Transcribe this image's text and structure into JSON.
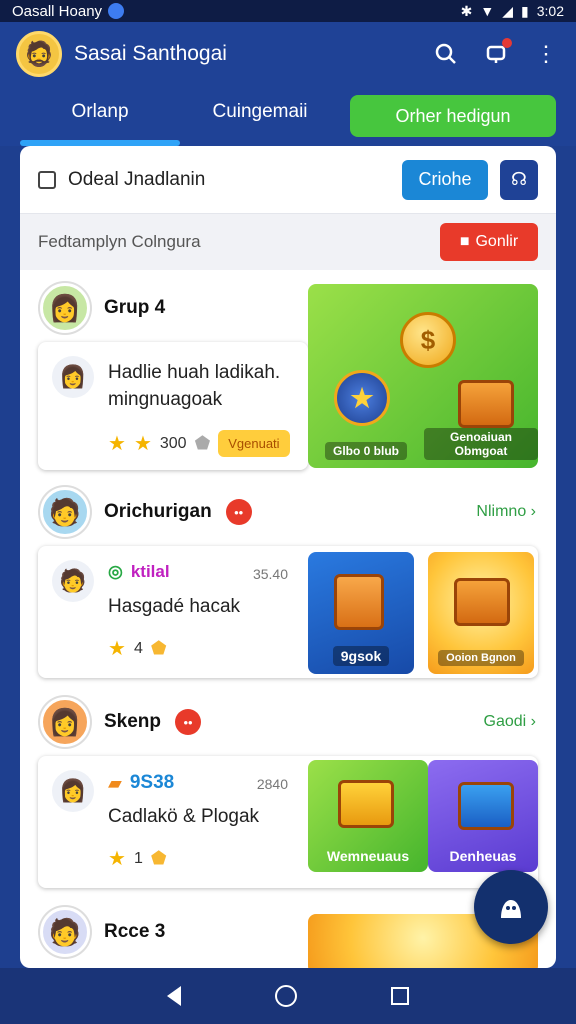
{
  "status": {
    "carrier": "Oasall Hoany",
    "time": "3:02"
  },
  "appbar": {
    "title": "Sasai Santhogai",
    "search_icon": "search-icon",
    "notif_icon": "notification-icon",
    "more_icon": "more-vert-icon"
  },
  "tabs": [
    {
      "label": "Orlanp",
      "active": true
    },
    {
      "label": "Cuingemaii",
      "active": false
    }
  ],
  "tab_cta": {
    "label": "Orher hedigun"
  },
  "filter": {
    "label": "Odeal Jnadlanin",
    "button": "Criohe"
  },
  "notice": {
    "label": "Fedtamplyn Colngura",
    "button": "Gonlir"
  },
  "sections": [
    {
      "title": "Grup 4",
      "card": {
        "text1": "Hadlie huah ladikah.",
        "text2": "mingnuagoak",
        "score": "300",
        "pill": "Vgenuati"
      },
      "tile": {
        "left_label": "Glbo 0 blub",
        "right_label": "Genoaiuan Obmgoat"
      }
    },
    {
      "title": "Orichurigan",
      "link": "Nlimno",
      "card": {
        "tag": "ktilal",
        "time": "35.40",
        "text": "Hasgadé hacak",
        "score": "4"
      },
      "tiles": [
        {
          "label": "9gsok"
        },
        {
          "label": "Ooion Bgnon"
        }
      ]
    },
    {
      "title": "Skenp",
      "link": "Gaodi",
      "card": {
        "tag": "9S38",
        "time": "2840",
        "text": "Cadlakö & Plogak",
        "score": "1"
      },
      "tile": {
        "left_label": "Wemneuaus",
        "right_label": "Denheuas"
      }
    },
    {
      "title": "Rcce 3"
    }
  ],
  "colors": {
    "primary": "#1f4296",
    "accent_green": "#47c63e",
    "accent_blue": "#1b87d6",
    "accent_red": "#e83a2a"
  }
}
